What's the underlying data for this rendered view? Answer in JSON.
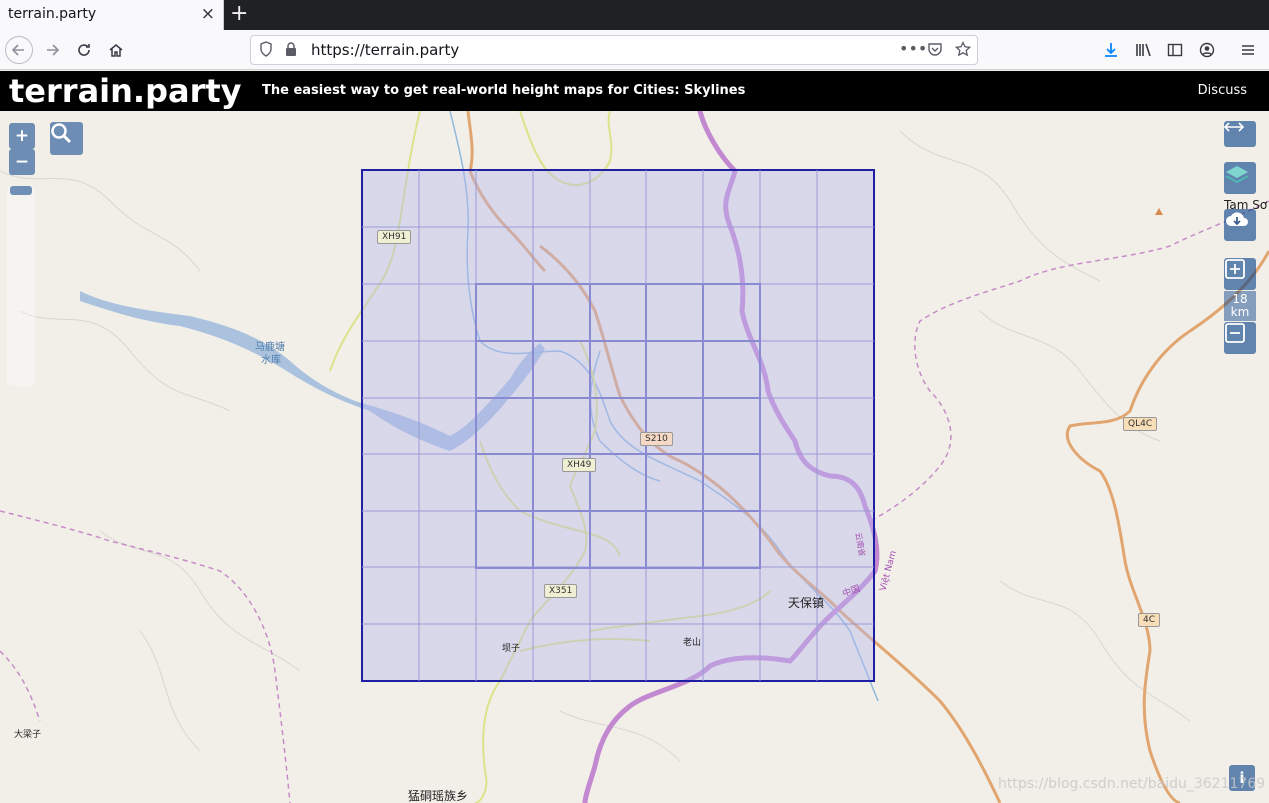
{
  "browser": {
    "tab_title": "terrain.party",
    "tab_close": "×",
    "new_tab": "+",
    "url": "https://terrain.party"
  },
  "site": {
    "title": "terrain.party",
    "tagline": "The easiest way to get real-world height maps for Cities: Skylines",
    "discuss": "Discuss"
  },
  "map": {
    "zoom_in": "+",
    "zoom_out": "−",
    "scale_value": "18",
    "scale_unit": "km",
    "labels": {
      "reservoir_line1": "马鹿塘",
      "reservoir_line2": "水库",
      "town": "天保镇",
      "laoshan": "老山",
      "bazi": "坝子",
      "daliangzi": "大梁子",
      "township": "猛硐瑶族乡",
      "tamso": "Tam Sơ",
      "china": "中国",
      "vietnam": "Việt Nam",
      "yunnan": "云南省"
    },
    "road_shields": {
      "xh91": "XH91",
      "s210": "S210",
      "xh49": "XH49",
      "x351": "X351",
      "ql4c": "QL4C",
      "r4c": "4C"
    },
    "info": "i",
    "watermark": "https://blog.csdn.net/baidu_36211769"
  },
  "colors": {
    "selection_fill": "#b8b8ef",
    "selection_border": "#1f1fa3",
    "border_line": "#c07dcc",
    "water": "#9fc9e4",
    "major_road": "#e8a873",
    "minor_road": "#e9ed8e"
  }
}
